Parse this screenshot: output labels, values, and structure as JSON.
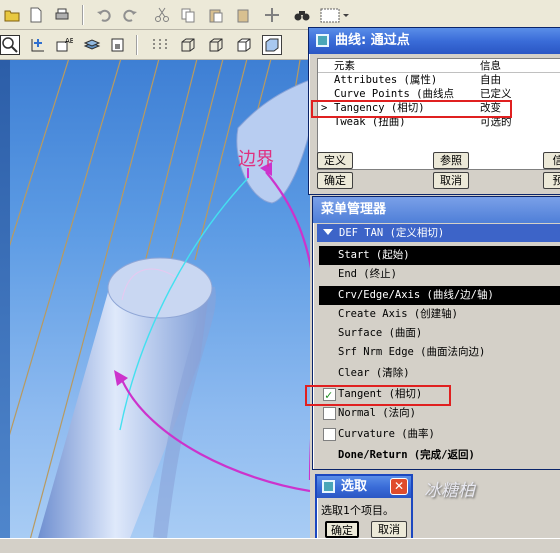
{
  "canvas": {
    "boundary_label": "边界"
  },
  "curve_dialog": {
    "title": "曲线: 通过点",
    "col_element": "元素",
    "col_info": "信息",
    "rows": [
      {
        "element": "Attributes (属性)",
        "info": "自由"
      },
      {
        "element": "Curve Points (曲线点",
        "info": "已定义"
      },
      {
        "element": "Tangency (相切)",
        "info": "改变"
      },
      {
        "element": "Tweak (扭曲)",
        "info": "可选的"
      }
    ],
    "buttons": {
      "define": "定义",
      "ref": "参照",
      "info": "信",
      "ok": "确定",
      "cancel": "取消",
      "preview": "预"
    }
  },
  "menu_manager": {
    "title": "菜单管理器",
    "header": "DEF TAN (定义相切)",
    "items": [
      {
        "label": "Start (起始)",
        "active": true
      },
      {
        "label": "End (终止)",
        "active": false
      },
      {
        "label": "Crv/Edge/Axis (曲线/边/轴)",
        "active": true
      },
      {
        "label": "Create Axis (创建轴)",
        "active": false
      },
      {
        "label": "Surface (曲面)",
        "active": false
      },
      {
        "label": "Srf Nrm Edge (曲面法向边)",
        "active": false
      },
      {
        "label": "Clear (清除)",
        "active": false
      }
    ],
    "checks": [
      {
        "label": "Tangent (相切)",
        "checked": true
      },
      {
        "label": "Normal (法向)",
        "checked": false
      },
      {
        "label": "Curvature (曲率)",
        "checked": false
      }
    ],
    "done": "Done/Return (完成/返回)"
  },
  "select_dialog": {
    "title": "选取",
    "message": "选取1个项目。",
    "ok": "确定",
    "cancel": "取消"
  },
  "watermark": "冰糖柏",
  "colors": {
    "title_blue": "#2a56c4",
    "highlight_red": "#e02020",
    "arrow_magenta": "#cc33cc",
    "curve_cyan": "#44e0f0"
  }
}
